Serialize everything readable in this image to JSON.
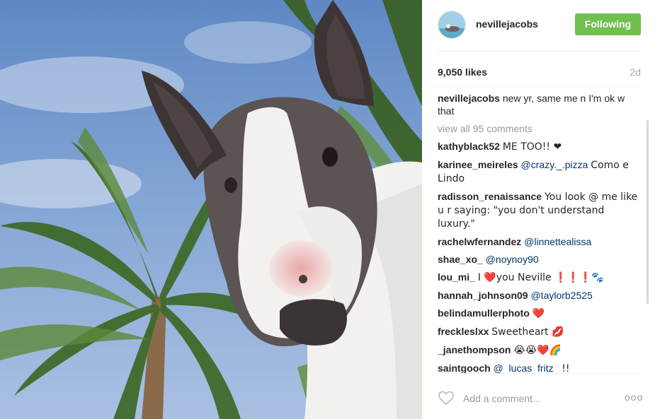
{
  "post": {
    "username": "nevillejacobs",
    "follow_label": "Following",
    "likes": "9,050 likes",
    "time": "2d",
    "caption_user": "nevillejacobs",
    "caption_text": "new yr, same me n I'm ok w that",
    "view_all": "view all 95 comments"
  },
  "comments": [
    {
      "user": "kathyblack52",
      "mention": "",
      "text": "ME TOO!! ❤"
    },
    {
      "user": "karinee_meireles",
      "mention": "@crazy._.pizza",
      "text": "Como e Lindo"
    },
    {
      "user": "radisson_renaissance",
      "mention": "",
      "text": "You look @ me like u r saying: \"you don't understand luxury.\""
    },
    {
      "user": "rachelwfernandez",
      "mention": "@linnettealissa",
      "text": ""
    },
    {
      "user": "shae_xo_",
      "mention": "@noynoy90",
      "text": ""
    },
    {
      "user": "lou_mi_",
      "mention": "",
      "text": "I ❤️you Neville ❗❗❗🐾"
    },
    {
      "user": "hannah_johnson09",
      "mention": "@taylorb2525",
      "text": ""
    },
    {
      "user": "belindamullerphoto",
      "mention": "",
      "text": "❤️"
    },
    {
      "user": "freckleslxx",
      "mention": "",
      "text": "Sweetheart 💋"
    },
    {
      "user": "_janethompson",
      "mention": "",
      "text": "😭😭❤️🌈"
    },
    {
      "user": "saintgooch",
      "mention": "@_lucas_fritz_",
      "text": "!!"
    }
  ],
  "footer": {
    "add_comment_placeholder": "Add a comment...",
    "more_label": "ooo"
  },
  "icons": {
    "heart": "heart-outline-icon",
    "more": "more-options-icon"
  },
  "colors": {
    "follow_button": "#70c050",
    "mention": "#003569",
    "muted": "#999999"
  }
}
